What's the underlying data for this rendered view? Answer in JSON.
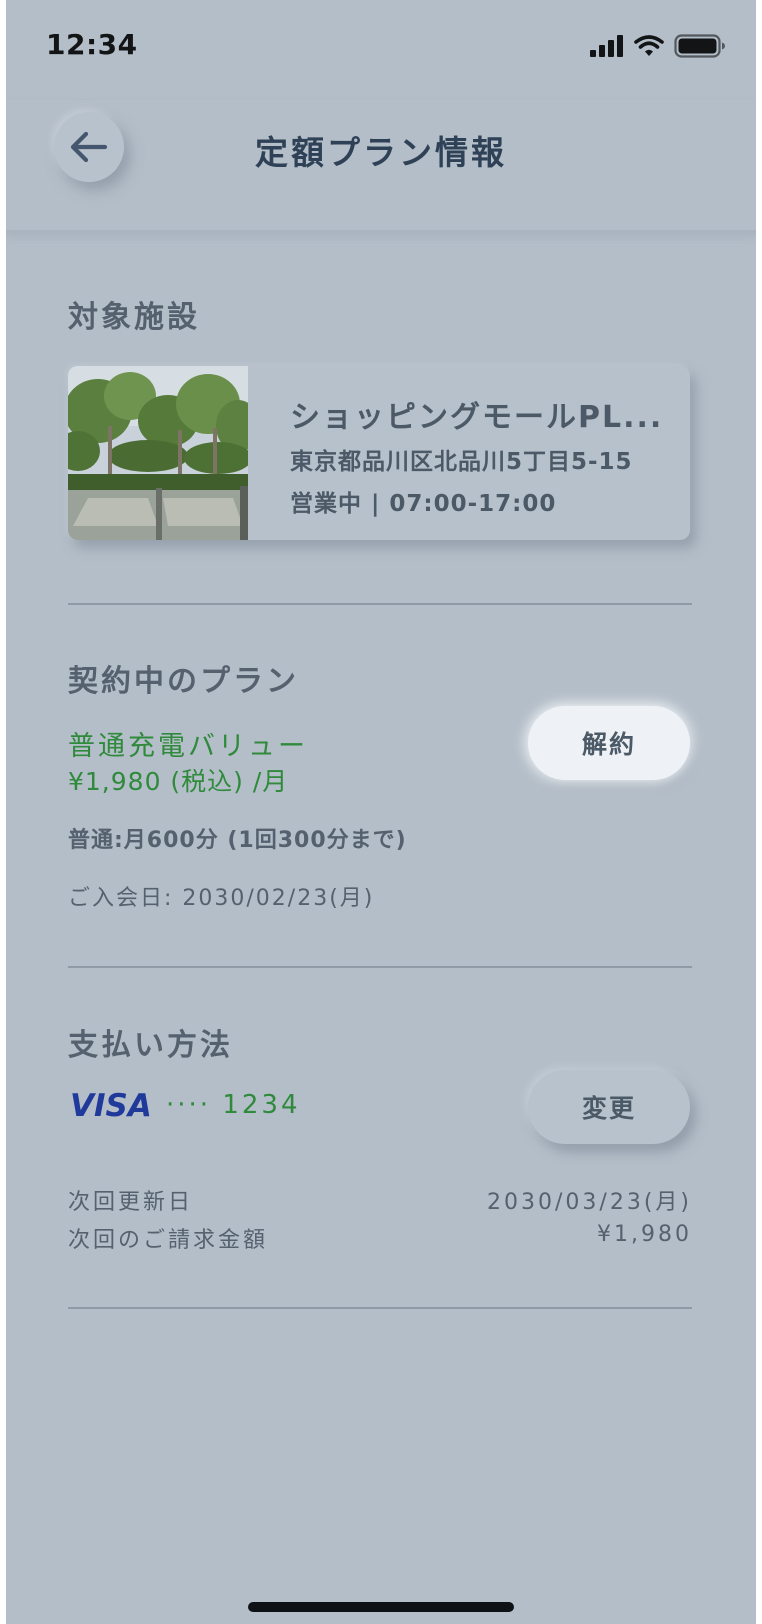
{
  "status_bar": {
    "time": "12:34"
  },
  "header": {
    "title": "定額プラン情報",
    "back_icon": "arrow-left-icon"
  },
  "facility_section": {
    "title": "対象施設",
    "card": {
      "name": "ショッピングモールPL...",
      "address": "東京都品川区北品川5丁目5-15",
      "hours": "営業中 | 07:00-17:00"
    }
  },
  "plan_section": {
    "title": "契約中のプラン",
    "plan_name": "普通充電バリュー",
    "price": "¥1,980 (税込) /月",
    "limit": "普通:月600分 (1回300分まで)",
    "join_date": "ご入会日: 2030/02/23(月)",
    "cancel_label": "解約"
  },
  "payment_section": {
    "title": "支払い方法",
    "card_brand": "VISA",
    "card_number": "···· 1234",
    "change_label": "変更",
    "next_renewal_label": "次回更新日",
    "next_renewal_value": "2030/03/23(月)",
    "next_billing_label": "次回のご請求金額",
    "next_billing_value": "¥1,980"
  },
  "colors": {
    "background": "#b4bec8",
    "accent_green": "#2f8a3c",
    "title_navy": "#2f4156",
    "visa_blue": "#1f3a9a"
  }
}
